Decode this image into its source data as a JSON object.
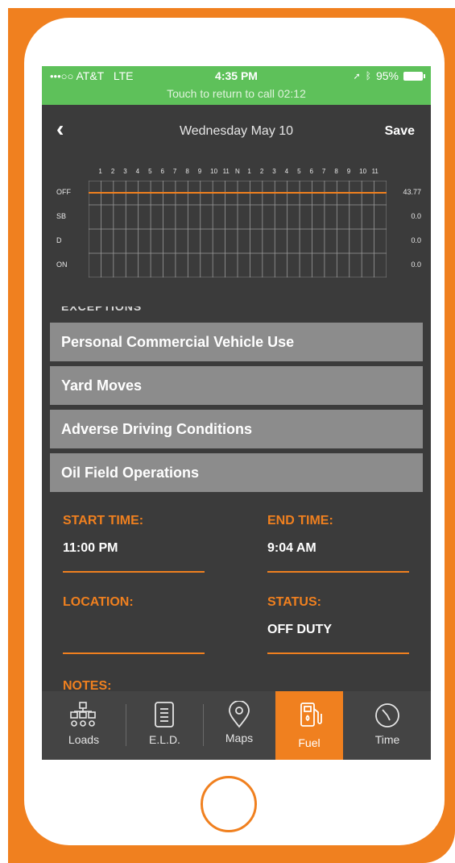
{
  "status_bar": {
    "signal": "•••○○",
    "carrier": "AT&T",
    "network": "LTE",
    "time": "4:35 PM",
    "battery": "95%",
    "call_banner": "Touch to return to call 02:12"
  },
  "header": {
    "back": "‹",
    "title": "Wednesday May 10",
    "save": "Save"
  },
  "log_graph": {
    "hours": [
      "1",
      "2",
      "3",
      "4",
      "5",
      "6",
      "7",
      "8",
      "9",
      "10",
      "11",
      "N",
      "1",
      "2",
      "3",
      "4",
      "5",
      "6",
      "7",
      "8",
      "9",
      "10",
      "11"
    ],
    "rows": [
      {
        "label": "OFF",
        "value": "43.77"
      },
      {
        "label": "SB",
        "value": "0.0"
      },
      {
        "label": "D",
        "value": "0.0"
      },
      {
        "label": "ON",
        "value": "0.0"
      }
    ],
    "line_color": "#f0801f"
  },
  "exceptions": {
    "section_label": "EXCEPTIONS",
    "items": [
      "Personal Commercial Vehicle Use",
      "Yard Moves",
      "Adverse Driving Conditions",
      "Oil Field Operations"
    ]
  },
  "form": {
    "start_time_label": "START TIME:",
    "start_time_value": "11:00 PM",
    "end_time_label": "END TIME:",
    "end_time_value": "9:04 AM",
    "location_label": "LOCATION:",
    "location_value": "",
    "status_label": "STATUS:",
    "status_value": "OFF DUTY",
    "notes_label": "NOTES:"
  },
  "tabs": [
    {
      "label": "Loads",
      "icon": "loads-icon"
    },
    {
      "label": "E.L.D.",
      "icon": "eld-icon"
    },
    {
      "label": "Maps",
      "icon": "map-pin-icon"
    },
    {
      "label": "Fuel",
      "icon": "fuel-pump-icon",
      "active": true
    },
    {
      "label": "Time",
      "icon": "clock-icon"
    }
  ],
  "colors": {
    "accent": "#f0801f",
    "status_green": "#5ec15a",
    "screen_bg": "#3b3b3b",
    "button_gray": "#8c8c8c"
  }
}
